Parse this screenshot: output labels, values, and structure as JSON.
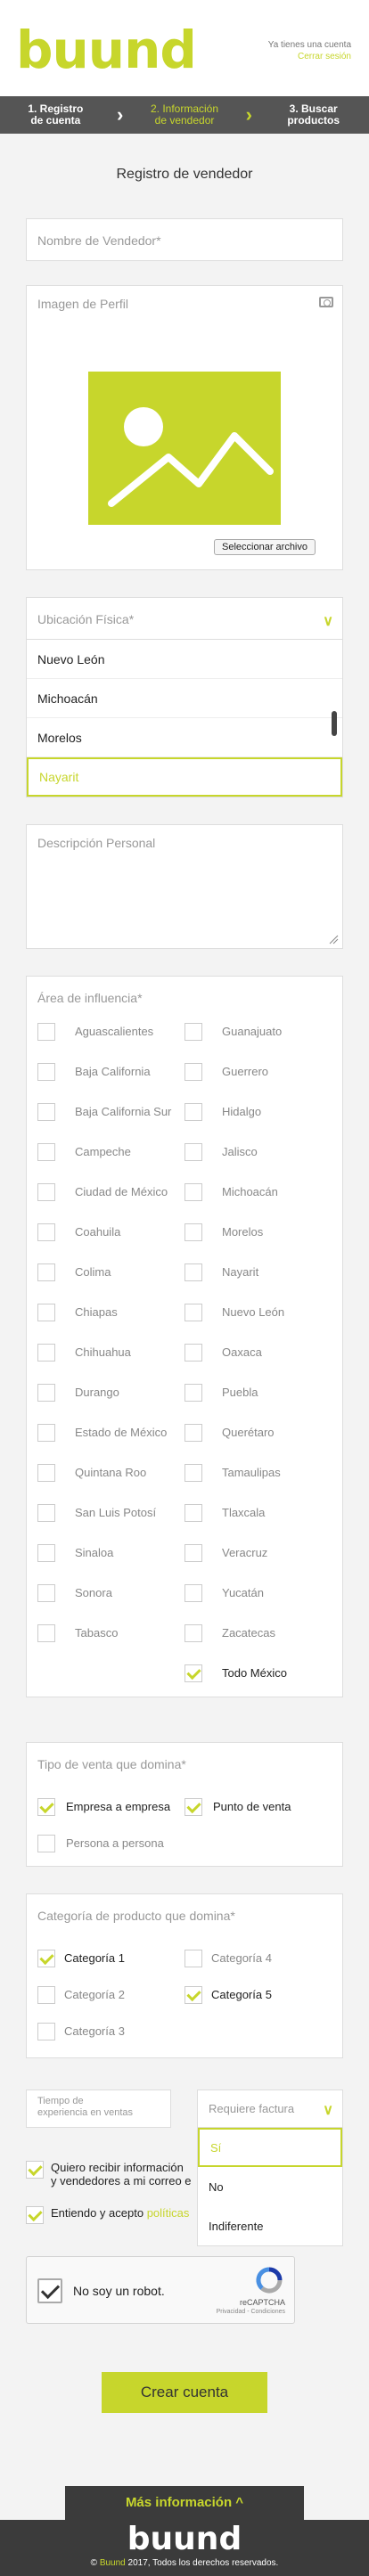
{
  "header": {
    "logo": "buund",
    "account_question": "Ya tienes una cuenta",
    "account_link": "Cerrar sesión"
  },
  "steps": [
    {
      "line1": "1. Registro",
      "line2": "de cuenta"
    },
    {
      "line1": "2. Información",
      "line2": "de vendedor"
    },
    {
      "line1": "3. Buscar",
      "line2": "productos"
    }
  ],
  "page_title": "Registro de vendedor",
  "vendor_name": {
    "placeholder": "Nombre de Vendedor*"
  },
  "profile": {
    "label": "Imagen de Perfil",
    "file_button": "Seleccionar archivo"
  },
  "location": {
    "placeholder": "Ubicación Física*",
    "options": [
      "Nuevo León",
      "Michoacán",
      "Morelos",
      "Nayarit"
    ],
    "selected": "Nayarit"
  },
  "description": {
    "placeholder": "Descripción Personal"
  },
  "area": {
    "label": "Área de influencia*",
    "states": [
      {
        "name": "Aguascalientes",
        "checked": false
      },
      {
        "name": "Guanajuato",
        "checked": false
      },
      {
        "name": "Baja California",
        "checked": false
      },
      {
        "name": "Guerrero",
        "checked": false
      },
      {
        "name": "Baja California Sur",
        "checked": false
      },
      {
        "name": "Hidalgo",
        "checked": false
      },
      {
        "name": "Campeche",
        "checked": false
      },
      {
        "name": "Jalisco",
        "checked": false
      },
      {
        "name": "Ciudad de México",
        "checked": false
      },
      {
        "name": "Michoacán",
        "checked": false
      },
      {
        "name": "Coahuila",
        "checked": false
      },
      {
        "name": "Morelos",
        "checked": false
      },
      {
        "name": "Colima",
        "checked": false
      },
      {
        "name": "Nayarit",
        "checked": false
      },
      {
        "name": "Chiapas",
        "checked": false
      },
      {
        "name": "Nuevo León",
        "checked": false
      },
      {
        "name": "Chihuahua",
        "checked": false
      },
      {
        "name": "Oaxaca",
        "checked": false
      },
      {
        "name": "Durango",
        "checked": false
      },
      {
        "name": "Puebla",
        "checked": false
      },
      {
        "name": "Estado de México",
        "checked": false
      },
      {
        "name": "Querétaro",
        "checked": false
      },
      {
        "name": "Quintana Roo",
        "checked": false
      },
      {
        "name": "Tamaulipas",
        "checked": false
      },
      {
        "name": "San Luis Potosí",
        "checked": false
      },
      {
        "name": "Tlaxcala",
        "checked": false
      },
      {
        "name": "Sinaloa",
        "checked": false
      },
      {
        "name": "Veracruz",
        "checked": false
      },
      {
        "name": "Sonora",
        "checked": false
      },
      {
        "name": "Yucatán",
        "checked": false
      },
      {
        "name": "Tabasco",
        "checked": false
      },
      {
        "name": "Zacatecas",
        "checked": false
      },
      {
        "name": "",
        "checked": null
      },
      {
        "name": "Todo México",
        "checked": true
      }
    ]
  },
  "sales_type": {
    "label": "Tipo de venta que domina*",
    "options": [
      {
        "name": "Empresa a empresa",
        "checked": true
      },
      {
        "name": "Punto de venta",
        "checked": true
      },
      {
        "name": "Persona a persona",
        "checked": false
      }
    ]
  },
  "category": {
    "label": "Categoría de producto que domina*",
    "options": [
      {
        "name": "Categoría 1",
        "checked": true
      },
      {
        "name": "Categoría 4",
        "checked": false
      },
      {
        "name": "Categoría 2",
        "checked": false
      },
      {
        "name": "Categoría 5",
        "checked": true
      },
      {
        "name": "Categoría 3",
        "checked": false
      }
    ]
  },
  "experience": {
    "placeholder_line1": "Tiempo de",
    "placeholder_line2": "experiencia en ventas"
  },
  "invoice": {
    "placeholder": "Requiere factura",
    "options": [
      "Sí",
      "No",
      "Indiferente"
    ],
    "selected": "Sí"
  },
  "agreements": {
    "newsletter_line1": "Quiero recibir información",
    "newsletter_line2": "y vendedores a mi correo e",
    "terms_prefix": "Entiendo y acepto",
    "terms_link": "políticas"
  },
  "recaptcha": {
    "label": "No soy un robot.",
    "brand": "reCAPTCHA",
    "sub": "Privacidad - Condiciones"
  },
  "create_button": "Crear cuenta",
  "more_info": "Más información ^",
  "footer": {
    "logo": "buund",
    "copyright_prefix": "© ",
    "copyright_brand": "Buund",
    "copyright_rest": " 2017, Todos los derechos reservados."
  },
  "colors": {
    "accent": "#c7d62c",
    "dark": "#3b3b3b",
    "steps_bg": "#555555"
  }
}
